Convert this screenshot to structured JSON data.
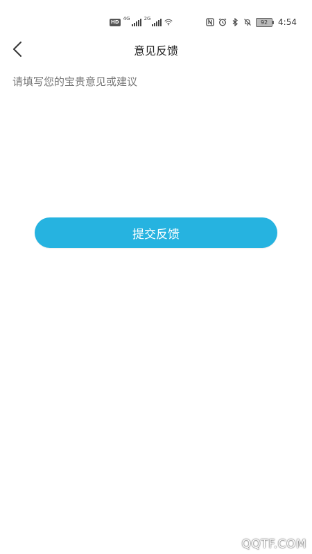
{
  "status_bar": {
    "hd": "HD",
    "sim1_network": "4G",
    "sim2_network": "2G",
    "battery_level": "92",
    "time": "4:54"
  },
  "header": {
    "title": "意见反馈",
    "back_icon": "chevron-left-icon"
  },
  "feedback": {
    "placeholder": "请填写您的宝贵意见或建议",
    "value": ""
  },
  "submit_button": {
    "label": "提交反馈"
  },
  "colors": {
    "accent": "#26b3e0",
    "background": "#ffffff",
    "title_text": "#222222",
    "placeholder_text": "#777777"
  },
  "watermark": "QQTF.COM"
}
